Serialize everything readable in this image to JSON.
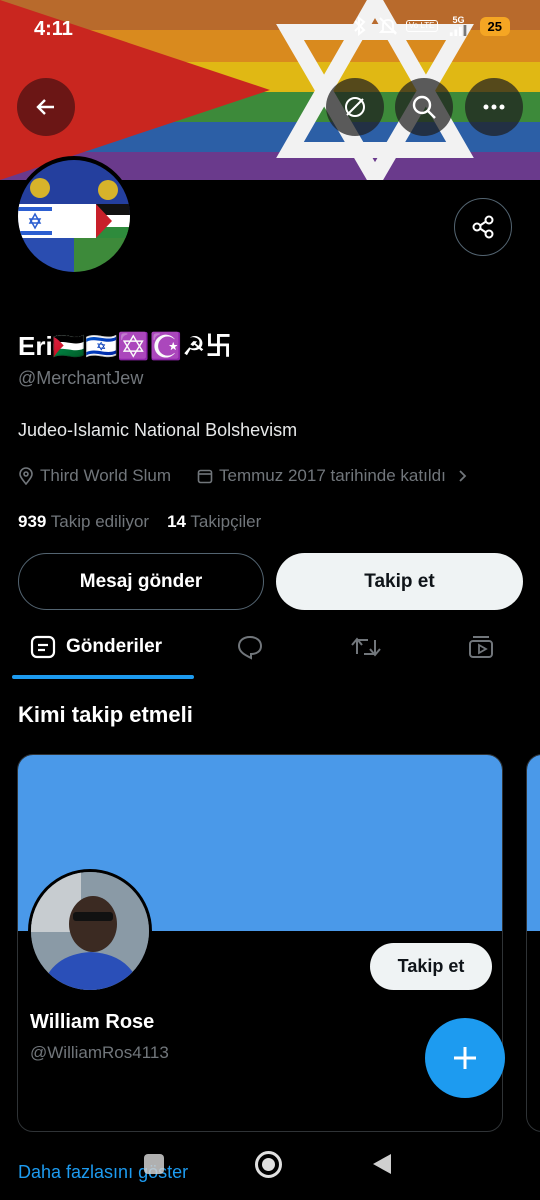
{
  "status_bar": {
    "time": "4:11",
    "battery": "25",
    "network": "5G",
    "volte": "Vo LTE",
    "icons": [
      "bluetooth-icon",
      "mute-icon",
      "volte-icon",
      "signal-icon",
      "battery-icon"
    ]
  },
  "header": {
    "actions": [
      "back-arrow-icon",
      "sync-icon",
      "search-icon",
      "more-icon"
    ]
  },
  "profile": {
    "name": "Eri🇵🇸🇮🇱✡️☪️☭卐",
    "handle": "@MerchantJew",
    "bio": "Judeo-Islamic National Bolshevism",
    "location": "Third World Slum",
    "joined": "Temmuz 2017 tarihinde katıldı",
    "following_count": "939",
    "following_label": "Takip ediliyor",
    "followers_count": "14",
    "followers_label": "Takipçiler",
    "message_button": "Mesaj gönder",
    "follow_button": "Takip et"
  },
  "tabs": {
    "posts_label": "Gönderiler",
    "icons": [
      "posts-icon",
      "replies-icon",
      "reposts-icon",
      "media-icon"
    ]
  },
  "who_to_follow": {
    "title": "Kimi takip etmeli",
    "card": {
      "name": "William Rose",
      "handle": "@WilliamRos4113",
      "follow_button": "Takip et"
    },
    "show_more": "Daha fazlasını göster"
  },
  "colors": {
    "accent": "#1d9bf0",
    "card_banner": "#4a99e9",
    "battery": "#f5a623"
  }
}
